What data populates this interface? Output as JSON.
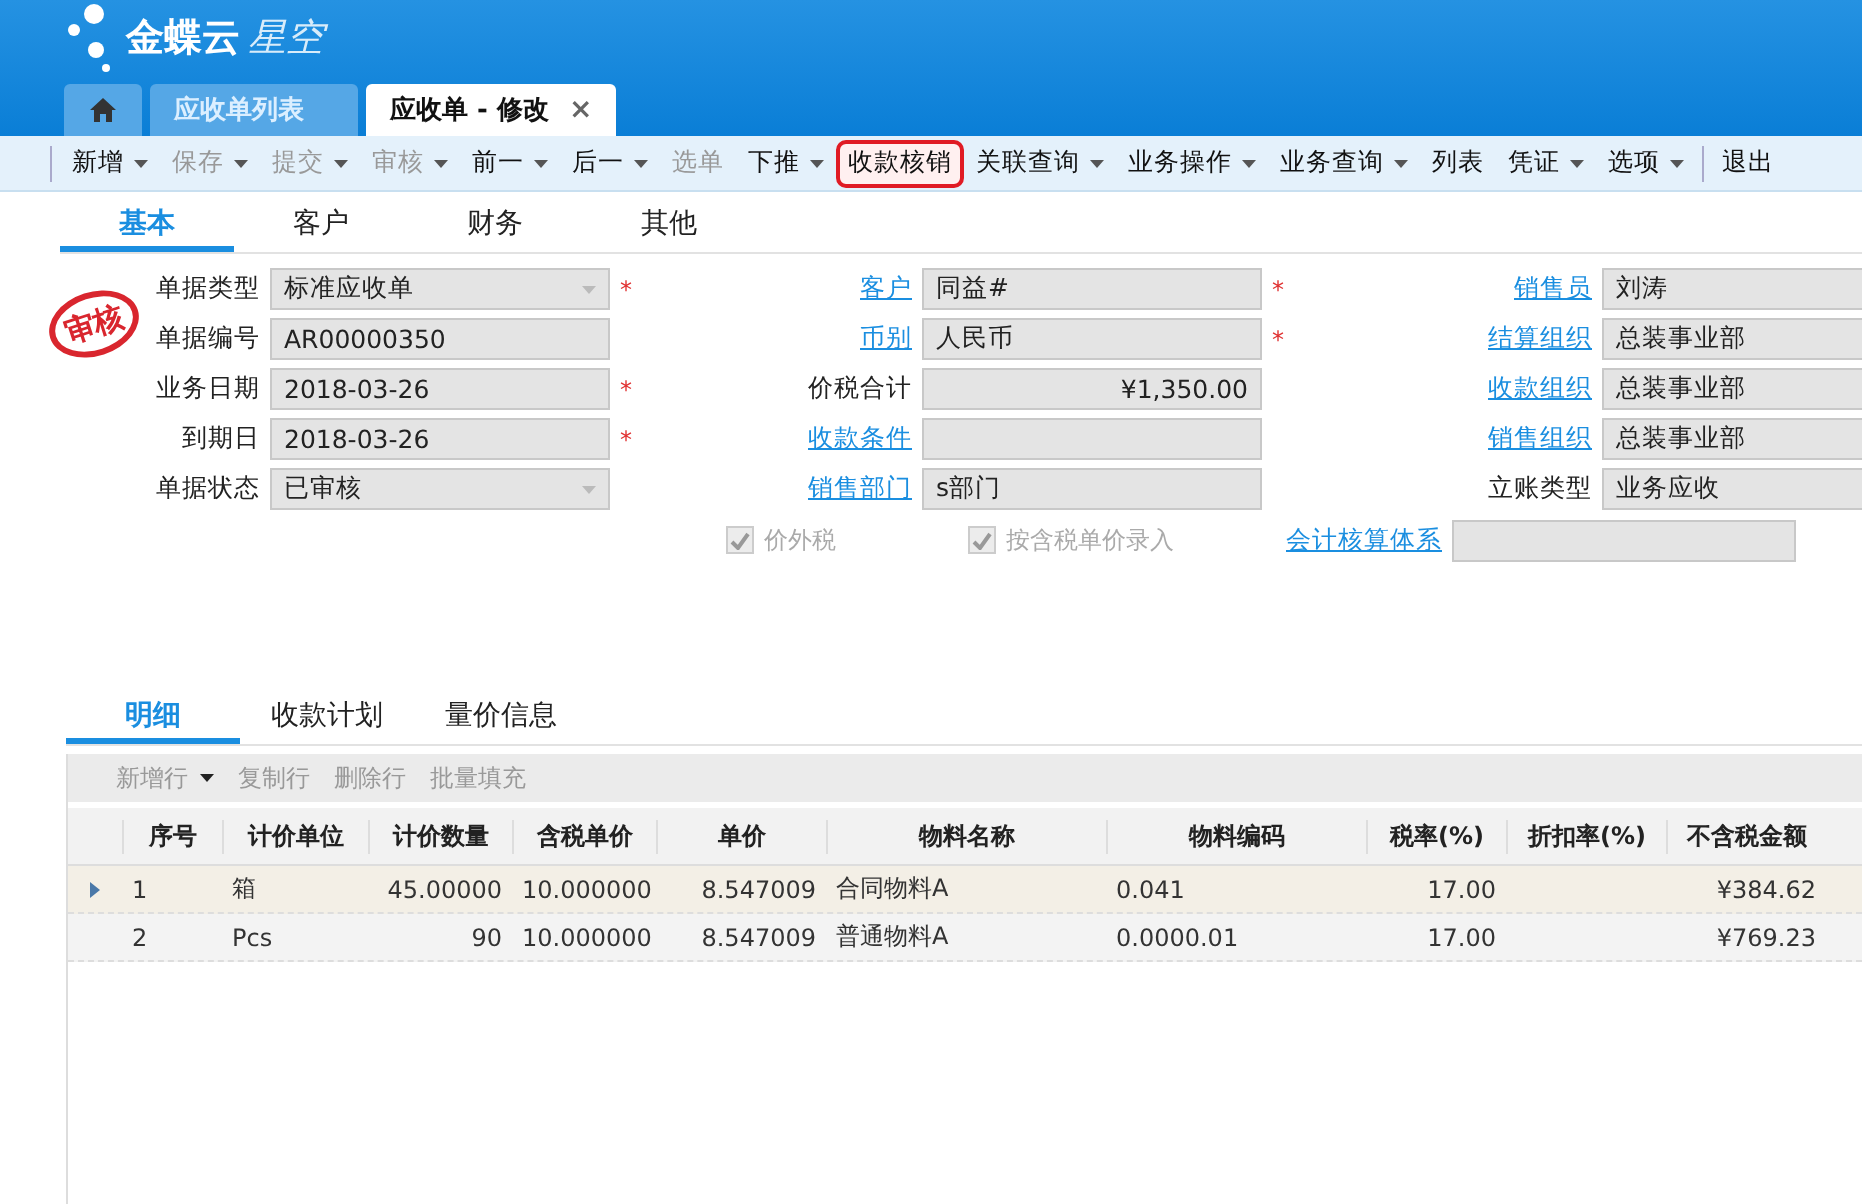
{
  "app": {
    "brand": "金蝶云",
    "product": "星空"
  },
  "tabs": [
    {
      "kind": "home",
      "selected": false
    },
    {
      "kind": "text",
      "label": "应收单列表",
      "selected": false
    },
    {
      "kind": "text",
      "label": "应收单 - 修改",
      "selected": true,
      "close": "×"
    }
  ],
  "toolbar": [
    {
      "label": "新增",
      "disabled": false,
      "dropdown": true,
      "highlighted": false
    },
    {
      "label": "保存",
      "disabled": true,
      "dropdown": true,
      "highlighted": false
    },
    {
      "label": "提交",
      "disabled": true,
      "dropdown": true,
      "highlighted": false
    },
    {
      "label": "审核",
      "disabled": true,
      "dropdown": true,
      "highlighted": false
    },
    {
      "label": "前一",
      "disabled": false,
      "dropdown": true,
      "highlighted": false
    },
    {
      "label": "后一",
      "disabled": false,
      "dropdown": true,
      "highlighted": false
    },
    {
      "label": "选单",
      "disabled": true,
      "highlighted": false
    },
    {
      "label": "下推",
      "disabled": false,
      "dropdown": true,
      "highlighted": false
    },
    {
      "label": "收款核销",
      "disabled": false,
      "highlighted": true
    },
    {
      "label": "关联查询",
      "disabled": false,
      "dropdown": true,
      "highlighted": false
    },
    {
      "label": "业务操作",
      "disabled": false,
      "dropdown": true,
      "highlighted": false
    },
    {
      "label": "业务查询",
      "disabled": false,
      "dropdown": true,
      "highlighted": false
    },
    {
      "label": "列表",
      "disabled": false,
      "highlighted": false
    },
    {
      "label": "凭证",
      "disabled": false,
      "dropdown": true,
      "highlighted": false
    },
    {
      "label": "选项",
      "disabled": false,
      "dropdown": true,
      "highlighted": false
    },
    {
      "label": "退出",
      "disabled": false,
      "highlighted": false,
      "separator_before": true
    }
  ],
  "form_tabs": [
    {
      "label": "基本",
      "selected": true
    },
    {
      "label": "客户",
      "selected": false
    },
    {
      "label": "财务",
      "selected": false
    },
    {
      "label": "其他",
      "selected": false
    }
  ],
  "form": {
    "stamp": "审核",
    "rows": [
      [
        {
          "label": "单据类型",
          "link": false,
          "value": "标准应收单",
          "required_mark": "*",
          "dropdown": true,
          "numeric": false
        },
        {
          "label": "客户",
          "link": true,
          "value": "同益#",
          "required_mark": "*",
          "numeric": false
        },
        {
          "label": "销售员",
          "link": true,
          "value": "刘涛",
          "numeric": false
        }
      ],
      [
        {
          "label": "单据编号",
          "link": false,
          "value": "AR00000350",
          "numeric": false
        },
        {
          "label": "币别",
          "link": true,
          "value": "人民币",
          "required_mark": "*",
          "numeric": false
        },
        {
          "label": "结算组织",
          "link": true,
          "value": "总装事业部",
          "numeric": false
        }
      ],
      [
        {
          "label": "业务日期",
          "link": false,
          "value": "2018-03-26",
          "required_mark": "*",
          "numeric": false
        },
        {
          "label": "价税合计",
          "link": false,
          "value": "¥1,350.00",
          "numeric": true
        },
        {
          "label": "收款组织",
          "link": true,
          "value": "总装事业部",
          "numeric": false
        }
      ],
      [
        {
          "label": "到期日",
          "link": false,
          "value": "2018-03-26",
          "required_mark": "*",
          "numeric": false
        },
        {
          "label": "收款条件",
          "link": true,
          "numeric": false
        },
        {
          "label": "销售组织",
          "link": true,
          "value": "总装事业部",
          "numeric": false
        }
      ],
      [
        {
          "label": "单据状态",
          "link": false,
          "value": "已审核",
          "dropdown": true,
          "numeric": false
        },
        {
          "label": "销售部门",
          "link": true,
          "value": "s部门",
          "numeric": false
        },
        {
          "label": "立账类型",
          "link": false,
          "value": "业务应收",
          "numeric": false
        }
      ]
    ],
    "options": [
      {
        "kind": "checkbox",
        "label": "价外税",
        "checked": true,
        "disabled": true
      },
      {
        "kind": "checkbox",
        "label": "按含税单价录入",
        "checked": true,
        "disabled": true
      },
      {
        "kind": "field",
        "label": "会计核算体系",
        "link": true
      }
    ]
  },
  "detail_tabs": [
    {
      "label": "明细",
      "selected": true
    },
    {
      "label": "收款计划",
      "selected": false
    },
    {
      "label": "量价信息",
      "selected": false
    }
  ],
  "grid_toolbar": [
    {
      "label": "新增行",
      "dropdown": true,
      "disabled": true
    },
    {
      "label": "复制行",
      "disabled": true
    },
    {
      "label": "删除行",
      "disabled": true
    },
    {
      "label": "批量填充",
      "disabled": true
    }
  ],
  "table": {
    "columns": [
      "序号",
      "计价单位",
      "计价数量",
      "含税单价",
      "单价",
      "物料名称",
      "物料编码",
      "税率(%)",
      "折扣率(%)",
      "不含税金额"
    ],
    "rows": [
      {
        "selected": true,
        "cells": [
          "1",
          "箱",
          "45.00000",
          "10.000000",
          "8.547009",
          "合同物料A",
          "0.041",
          "17.00",
          null,
          "¥384.62"
        ]
      },
      {
        "selected": false,
        "cells": [
          "2",
          "Pcs",
          "90",
          "10.000000",
          "8.547009",
          "普通物料A",
          "0.0000.01",
          "17.00",
          null,
          "¥769.23"
        ]
      }
    ]
  }
}
